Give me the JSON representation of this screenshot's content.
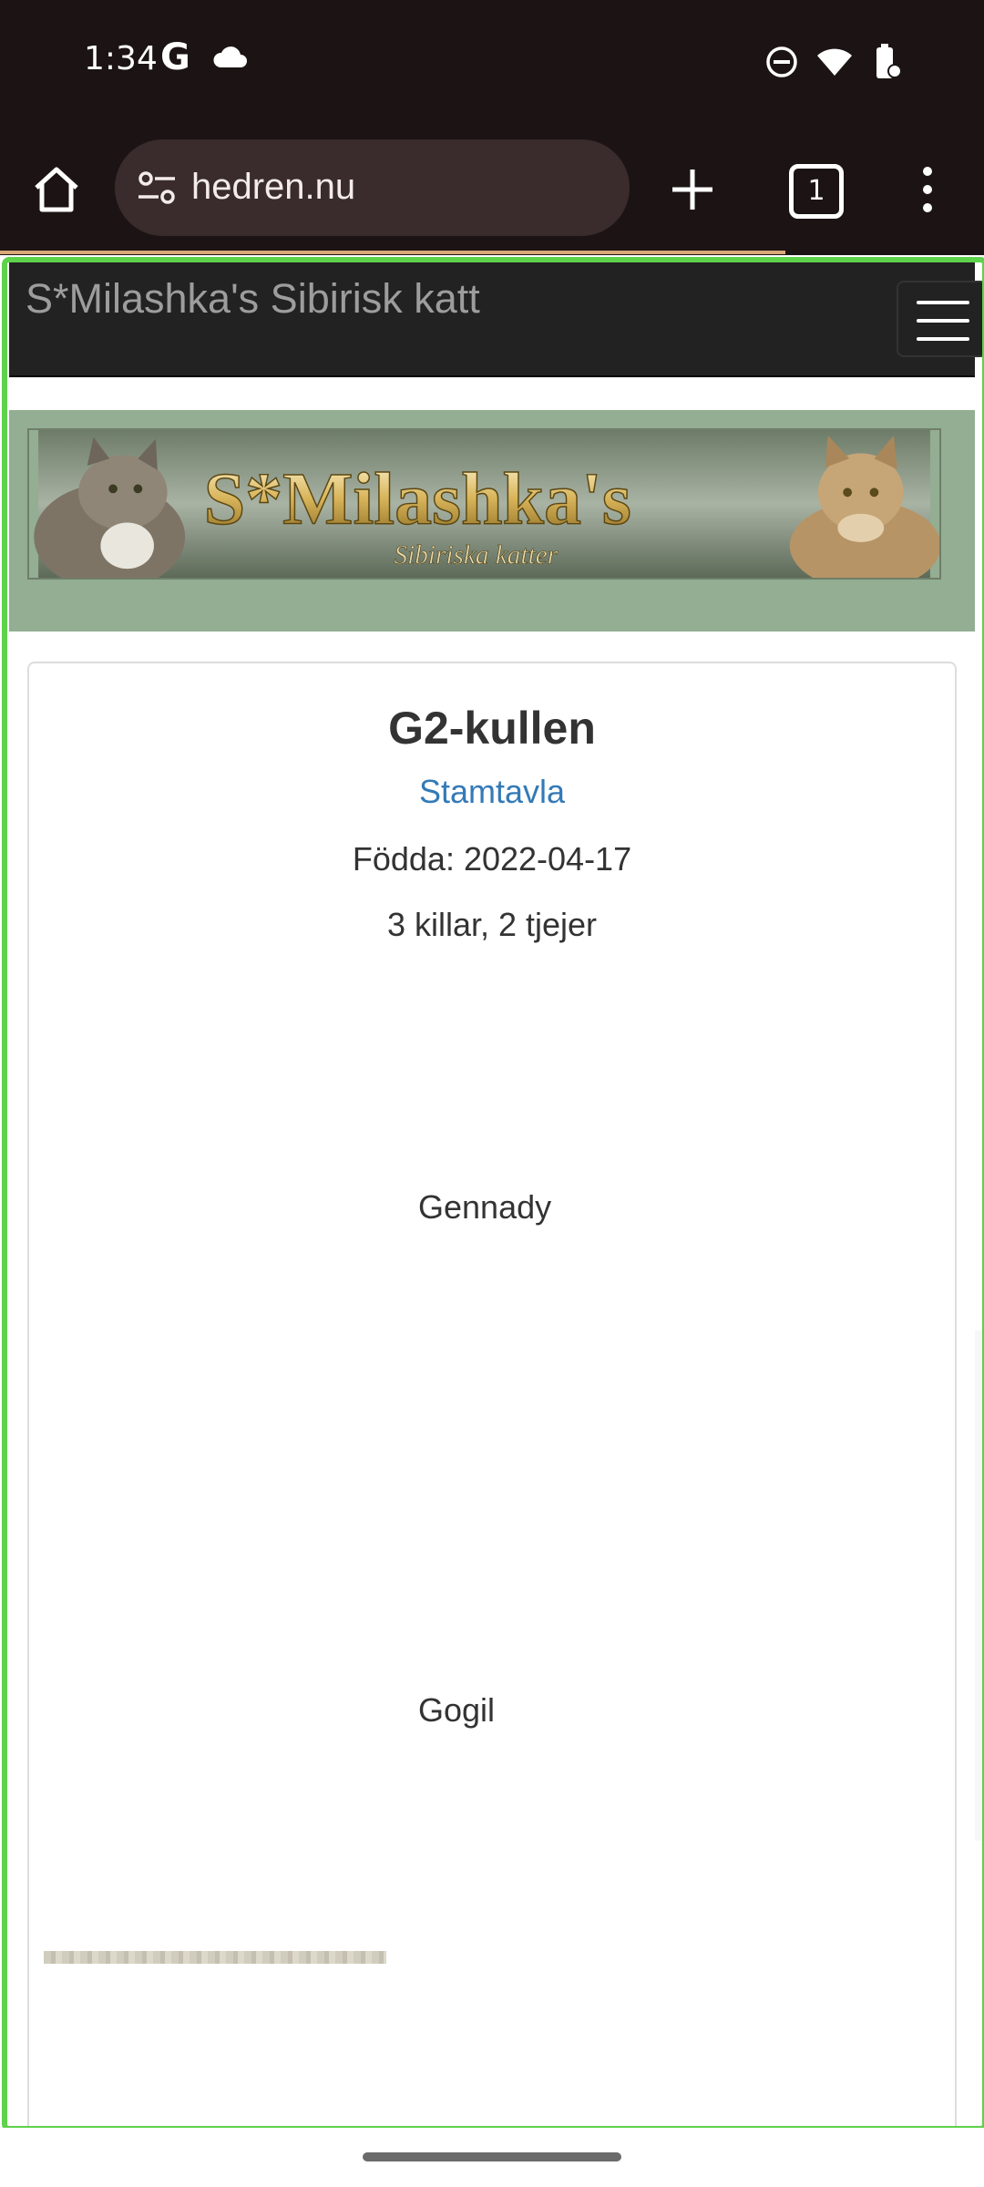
{
  "status_bar": {
    "time": "1:34",
    "google_glyph": "G",
    "icons": [
      "google-icon",
      "cloud-icon",
      "do-not-disturb-icon",
      "wifi-icon",
      "battery-icon"
    ]
  },
  "browser": {
    "url": "hedren.nu",
    "tab_count": "1",
    "icons": [
      "home-icon",
      "site-settings-icon",
      "new-tab-icon",
      "tab-switcher-icon",
      "more-menu-icon"
    ]
  },
  "site": {
    "brand": "S*Milashka's Sibirisk katt",
    "banner_title": "S*Milashka's",
    "banner_subtitle": "Sibiriska katter"
  },
  "litter": {
    "title": "G2-kullen",
    "pedigree_link": "Stamtavla",
    "born": "Födda: 2022-04-17",
    "count": "3 killar, 2 tjejer",
    "kittens": [
      "Gennady",
      "Gogil"
    ]
  },
  "colors": {
    "navbar_bg": "#222222",
    "banner_bg": "#93ae92",
    "link": "#337ab7",
    "highlight": "#5dd24a",
    "chrome_bg": "#1c1414"
  }
}
